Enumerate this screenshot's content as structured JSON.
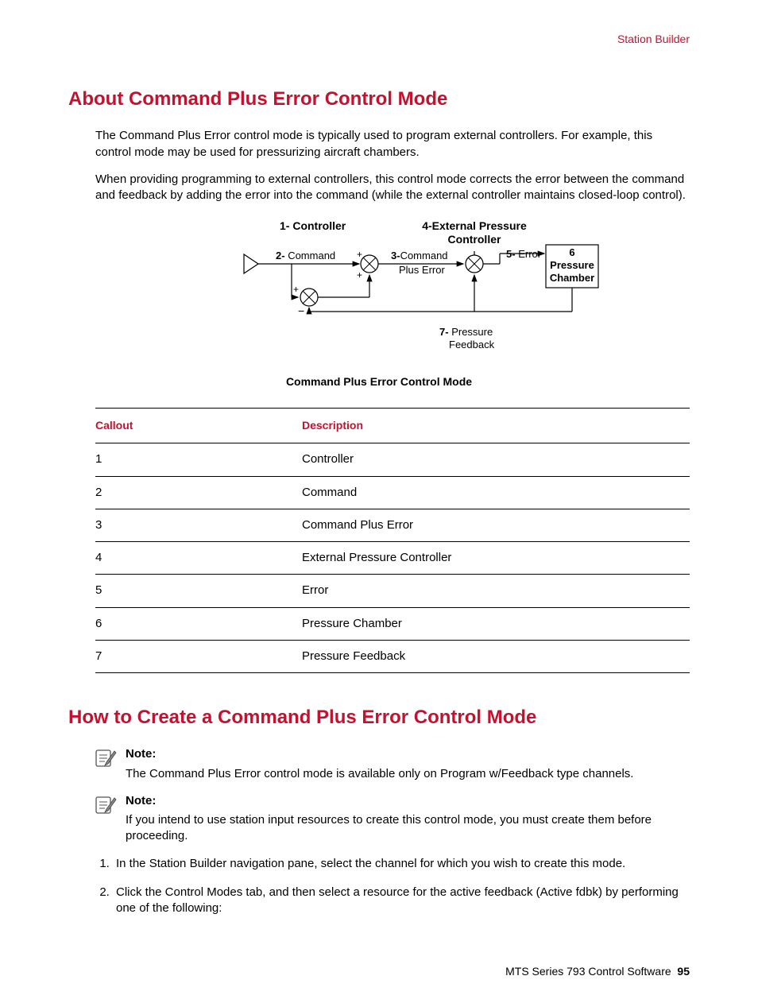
{
  "header": {
    "section": "Station Builder"
  },
  "section1": {
    "title": "About Command Plus Error Control Mode",
    "p1": "The Command Plus Error control mode is typically used to program external controllers. For example, this control mode may be used for pressurizing aircraft chambers.",
    "p2": "When providing programming to external controllers, this control mode corrects the error between the command and feedback by adding the error into the command (while the external controller maintains closed-loop control)."
  },
  "diagram": {
    "caption": "Command Plus Error Control Mode",
    "labels": {
      "l1a": "1-",
      "l1b": "Controller",
      "l2a": "2-",
      "l2b": "Command",
      "l3a": "3-",
      "l3b": "Command",
      "l3c": "Plus Error",
      "l4a": "4-External Pressure",
      "l4b": "Controller",
      "l5a": "5-",
      "l5b": "Error",
      "l6a": "6",
      "l6b": "Pressure",
      "l6c": "Chamber",
      "l7a": "7-",
      "l7b": "Pressure",
      "l7c": "Feedback"
    }
  },
  "table": {
    "headers": {
      "c1": "Callout",
      "c2": "Description"
    },
    "rows": [
      {
        "c": "1",
        "d": "Controller"
      },
      {
        "c": "2",
        "d": "Command"
      },
      {
        "c": "3",
        "d": "Command Plus Error"
      },
      {
        "c": "4",
        "d": "External Pressure Controller"
      },
      {
        "c": "5",
        "d": "Error"
      },
      {
        "c": "6",
        "d": "Pressure Chamber"
      },
      {
        "c": "7",
        "d": "Pressure Feedback"
      }
    ]
  },
  "section2": {
    "title": "How to Create a Command Plus Error Control Mode",
    "note_label": "Note:",
    "note1": "The Command Plus Error control mode is available only on Program w/Feedback type channels.",
    "note2": "If you intend to use station input resources to create this control mode, you must create them before proceeding.",
    "step1": "In the Station Builder navigation pane, select the channel for which you wish to create this mode.",
    "step2": "Click the Control Modes tab, and then select a resource for the active feedback (Active fdbk) by performing one of the following:"
  },
  "footer": {
    "doc": "MTS Series 793 Control Software",
    "page": "95"
  }
}
